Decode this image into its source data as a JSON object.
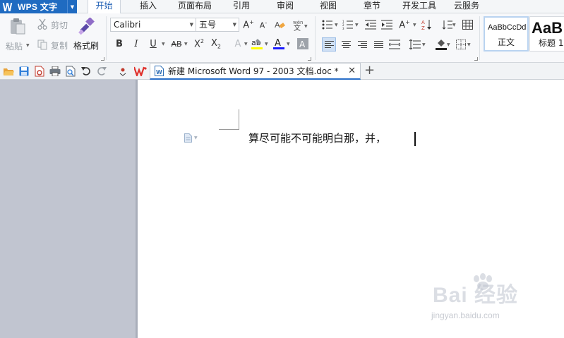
{
  "app": {
    "name": "WPS 文字"
  },
  "menu": {
    "tabs": [
      {
        "label": "开始",
        "active": true
      },
      {
        "label": "插入"
      },
      {
        "label": "页面布局"
      },
      {
        "label": "引用"
      },
      {
        "label": "审阅"
      },
      {
        "label": "视图"
      },
      {
        "label": "章节"
      },
      {
        "label": "开发工具"
      },
      {
        "label": "云服务"
      }
    ]
  },
  "ribbon": {
    "clipboard": {
      "paste": "粘贴",
      "cut": "剪切",
      "copy": "复制",
      "format_painter": "格式刷"
    },
    "font": {
      "family": "Calibri",
      "size": "五号"
    },
    "styles": [
      {
        "preview": "AaBbCcDd",
        "name": "正文",
        "selected": true
      },
      {
        "preview": "AaB",
        "name": "标题 1"
      }
    ]
  },
  "document_tab": {
    "title": "新建 Microsoft Word 97 - 2003 文档.doc *"
  },
  "document": {
    "text": "算尽可能不可能明白那，并，"
  },
  "watermark": {
    "main": "Bai 经验",
    "sub": "jingyan.baidu.com"
  },
  "colors": {
    "accent": "#1f6bc1",
    "gutter": "#c1c5d0",
    "highlight": "#ffff00",
    "font_color": "#1a1aff",
    "page": "#ffffff"
  }
}
